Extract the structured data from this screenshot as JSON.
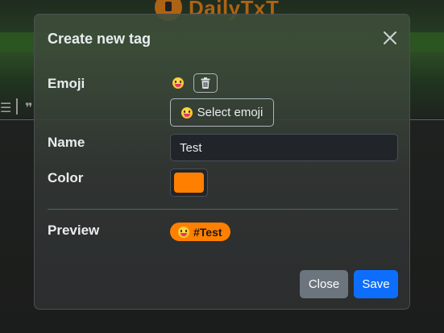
{
  "background": {
    "brand": "DailyTxT"
  },
  "modal": {
    "title": "Create new tag",
    "fields": {
      "emoji_label": "Emoji",
      "select_emoji_label": "Select emoji",
      "name_label": "Name",
      "name_value": "Test",
      "color_label": "Color",
      "color_value": "#ff8000",
      "preview_label": "Preview",
      "preview_tag": "#Test"
    },
    "footer": {
      "close_label": "Close",
      "save_label": "Save"
    }
  },
  "icons": {
    "close": "close-x-icon",
    "trash": "trash-icon",
    "emoji": "grinning-face-tongue-emoji"
  },
  "colors": {
    "accent": "#ff8000",
    "primary": "#0d6efd",
    "secondary": "#6c757d"
  }
}
